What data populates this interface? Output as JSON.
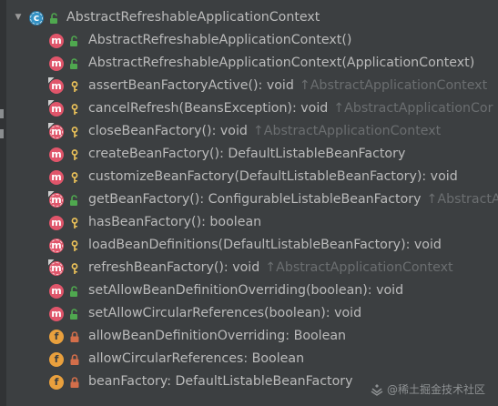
{
  "root": {
    "name": "AbstractRefreshableApplicationContext",
    "icon": "abstract-class-icon",
    "visibility": "public"
  },
  "members": [
    {
      "kind": "m",
      "icon": "method-icon",
      "visibility": "public",
      "label": "AbstractRefreshableApplicationContext()",
      "inherited": ""
    },
    {
      "kind": "m",
      "icon": "method-icon",
      "visibility": "public",
      "label": "AbstractRefreshableApplicationContext(ApplicationContext)",
      "inherited": ""
    },
    {
      "kind": "m",
      "icon": "method-icon",
      "visibility": "protected",
      "label": "assertBeanFactoryActive(): void",
      "inherited": "↑AbstractApplicationContext"
    },
    {
      "kind": "m",
      "icon": "method-icon",
      "visibility": "protected",
      "label": "cancelRefresh(BeansException): void",
      "inherited": "↑AbstractApplicationCor"
    },
    {
      "kind": "m",
      "icon": "method-icon",
      "visibility": "protected",
      "label": "closeBeanFactory(): void",
      "inherited": "↑AbstractApplicationContext",
      "abstract": true
    },
    {
      "kind": "m",
      "icon": "method-icon",
      "visibility": "protected",
      "label": "createBeanFactory(): DefaultListableBeanFactory",
      "inherited": ""
    },
    {
      "kind": "m",
      "icon": "method-icon",
      "visibility": "protected",
      "label": "customizeBeanFactory(DefaultListableBeanFactory): void",
      "inherited": ""
    },
    {
      "kind": "m",
      "icon": "method-icon",
      "visibility": "public",
      "label": "getBeanFactory(): ConfigurableListableBeanFactory",
      "inherited": "↑AbstractA",
      "abstract": true
    },
    {
      "kind": "m",
      "icon": "method-icon",
      "visibility": "protected",
      "label": "hasBeanFactory(): boolean",
      "inherited": ""
    },
    {
      "kind": "m",
      "icon": "method-icon",
      "visibility": "protected",
      "label": "loadBeanDefinitions(DefaultListableBeanFactory): void",
      "inherited": "",
      "abstract": true
    },
    {
      "kind": "m",
      "icon": "method-icon",
      "visibility": "protected",
      "label": "refreshBeanFactory(): void",
      "inherited": "↑AbstractApplicationContext",
      "abstract": true
    },
    {
      "kind": "m",
      "icon": "method-icon",
      "visibility": "public",
      "label": "setAllowBeanDefinitionOverriding(boolean): void",
      "inherited": ""
    },
    {
      "kind": "m",
      "icon": "method-icon",
      "visibility": "public",
      "label": "setAllowCircularReferences(boolean): void",
      "inherited": ""
    },
    {
      "kind": "f",
      "icon": "field-icon",
      "visibility": "private",
      "label": "allowBeanDefinitionOverriding: Boolean",
      "inherited": ""
    },
    {
      "kind": "f",
      "icon": "field-icon",
      "visibility": "private",
      "label": "allowCircularReferences: Boolean",
      "inherited": ""
    },
    {
      "kind": "f",
      "icon": "field-icon",
      "visibility": "private",
      "label": "beanFactory: DefaultListableBeanFactory",
      "inherited": ""
    }
  ],
  "watermark": "@稀土掘金技术社区",
  "colors": {
    "background": "#3c3f41",
    "text": "#bbbbbb",
    "inherited": "#6b6e70",
    "method": "#e0556a",
    "field": "#e9a03d",
    "class": "#3592c4",
    "public": "#4fa84f",
    "protected": "#f0c55a",
    "private": "#d36e4a"
  }
}
